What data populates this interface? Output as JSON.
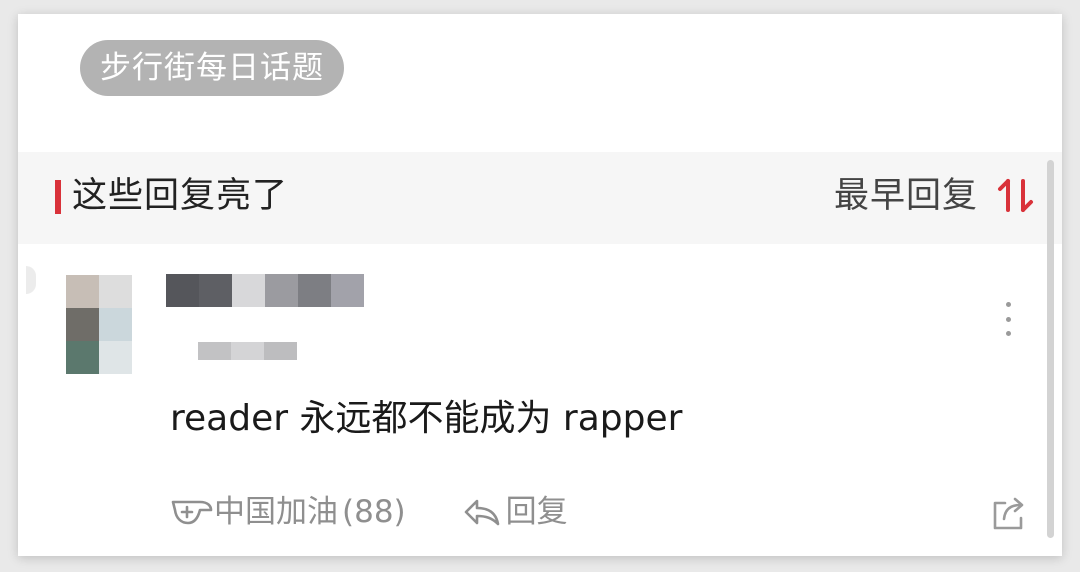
{
  "topic": {
    "label": "步行街每日话题"
  },
  "section": {
    "title": "这些回复亮了",
    "sort_label": "最早回复",
    "sort_icon": "sort-toggle-icon",
    "accent_color": "#d9323a"
  },
  "comment": {
    "text": "reader 永远都不能成为 rapper",
    "more_icon": "more-vertical-icon",
    "like_icon": "cheer-icon",
    "like_label": "中国加油",
    "like_count": "(88)",
    "reply_icon": "reply-arrow-icon",
    "reply_label": "回复",
    "share_icon": "share-icon"
  },
  "colors": {
    "topic_pill_bg": "#b3b3b3",
    "header_bg": "#f6f6f6",
    "action_text": "#8f8f8f"
  }
}
